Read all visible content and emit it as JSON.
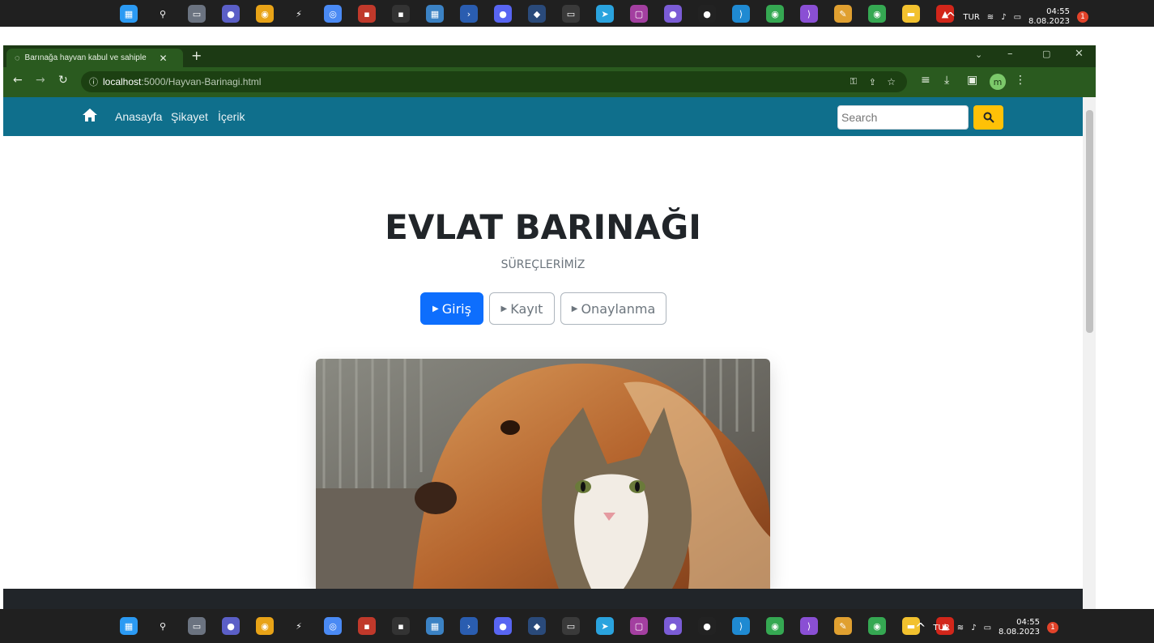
{
  "taskbar": {
    "language": "TUR",
    "time": "04:55",
    "date": "8.08.2023",
    "notification_count": "1",
    "apps": [
      {
        "name": "windows-start-icon",
        "color": "#2b9af3",
        "glyph": "▦"
      },
      {
        "name": "search-icon",
        "color": "#202020",
        "glyph": "⚲"
      },
      {
        "name": "task-view-icon",
        "color": "#6b7380",
        "glyph": "▭"
      },
      {
        "name": "meet-icon",
        "color": "#5b5fc7",
        "glyph": "●"
      },
      {
        "name": "chrome-icon",
        "color": "#e8a317",
        "glyph": "◉"
      },
      {
        "name": "winamp-icon",
        "color": "#202020",
        "glyph": "⚡"
      },
      {
        "name": "chrome-dev-icon",
        "color": "#4a8af4",
        "glyph": "◎"
      },
      {
        "name": "dev-icon",
        "color": "#c0392b",
        "glyph": "▪"
      },
      {
        "name": "epic-games-icon",
        "color": "#333",
        "glyph": "▪"
      },
      {
        "name": "ms-store-icon",
        "color": "#3b82c4",
        "glyph": "▦"
      },
      {
        "name": "powershell-icon",
        "color": "#2a5db0",
        "glyph": "›"
      },
      {
        "name": "discord-icon",
        "color": "#5865f2",
        "glyph": "●"
      },
      {
        "name": "steam-icon",
        "color": "#2a4a7a",
        "glyph": "◆"
      },
      {
        "name": "terminal-icon",
        "color": "#3a3a3a",
        "glyph": "▭"
      },
      {
        "name": "telegram-icon",
        "color": "#2aa3de",
        "glyph": "➤"
      },
      {
        "name": "snipping-icon",
        "color": "#a33fa0",
        "glyph": "▢"
      },
      {
        "name": "viber-icon",
        "color": "#7b5cd6",
        "glyph": "●"
      },
      {
        "name": "app-icon",
        "color": "#222",
        "glyph": "●"
      },
      {
        "name": "vscode-icon",
        "color": "#1f8ad2",
        "glyph": "⟩"
      },
      {
        "name": "chrome-beta-icon",
        "color": "#35a852",
        "glyph": "◉"
      },
      {
        "name": "visual-studio-icon",
        "color": "#8a4fd4",
        "glyph": "⟩"
      },
      {
        "name": "paint-icon",
        "color": "#e0a030",
        "glyph": "✎"
      },
      {
        "name": "chrome-profile-icon",
        "color": "#35a852",
        "glyph": "◉"
      },
      {
        "name": "file-explorer-icon",
        "color": "#f2c12e",
        "glyph": "▬"
      },
      {
        "name": "acrobat-icon",
        "color": "#d2261a",
        "glyph": "▲"
      }
    ]
  },
  "browser": {
    "tab_title": "Barınağa hayvan kabul ve sahiple",
    "url_host": "localhost",
    "url_path": ":5000/Hayvan-Barinagi.html",
    "profile_initial": "m"
  },
  "page": {
    "nav": {
      "home": "Anasayfa",
      "complaint": "Şikayet",
      "content": "İçerik"
    },
    "search_placeholder": "Search",
    "title": "EVLAT BARINAĞI",
    "subtitle": "SÜREÇLERİMİZ",
    "buttons": {
      "login": "Giriş",
      "register": "Kayıt",
      "approval": "Onaylanma"
    }
  },
  "colors": {
    "navbar": "#0f6f8c",
    "primary": "#0d6efd",
    "warning": "#ffc107",
    "browser_frame": "#2a5a1f"
  }
}
